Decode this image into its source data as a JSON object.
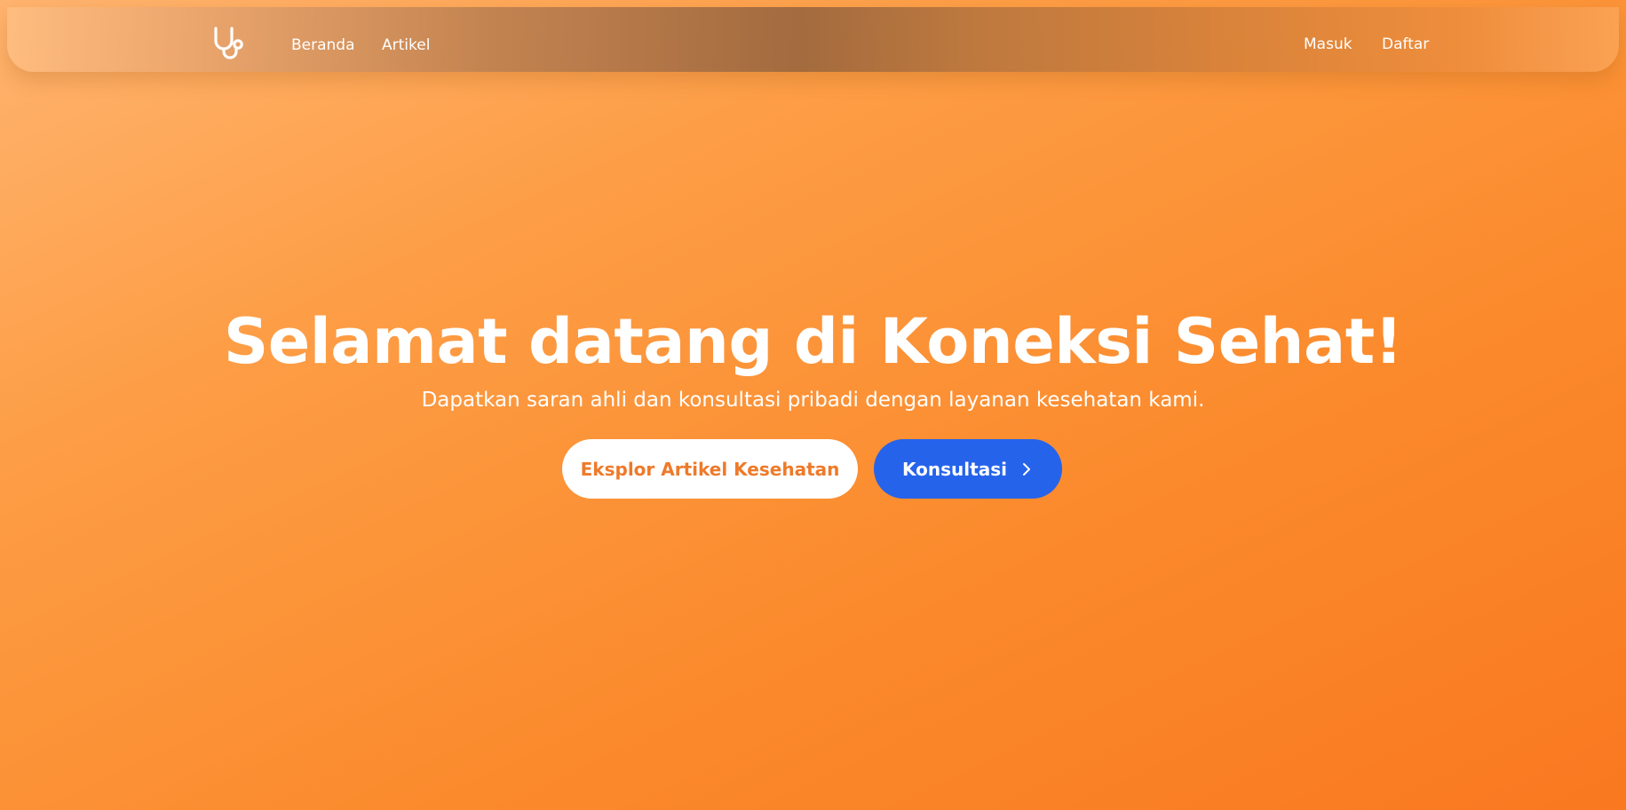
{
  "nav": {
    "logo_icon": "stethoscope-icon",
    "links": {
      "home": "Beranda",
      "articles": "Artikel",
      "login": "Masuk",
      "register": "Daftar"
    }
  },
  "hero": {
    "title": "Selamat datang di Koneksi Sehat!",
    "subtitle": "Dapatkan saran ahli dan konsultasi pribadi dengan layanan kesehatan kami.",
    "buttons": {
      "explore_label": "Eksplor Artikel Kesehatan",
      "consult_label": "Konsultasi",
      "consult_icon": "chevron-right-icon"
    }
  },
  "colors": {
    "background_start": "#ffb46f",
    "background_end": "#f97820",
    "explore_text": "#ee7a2a",
    "consult_bg": "#2563eb",
    "text": "#ffffff"
  }
}
